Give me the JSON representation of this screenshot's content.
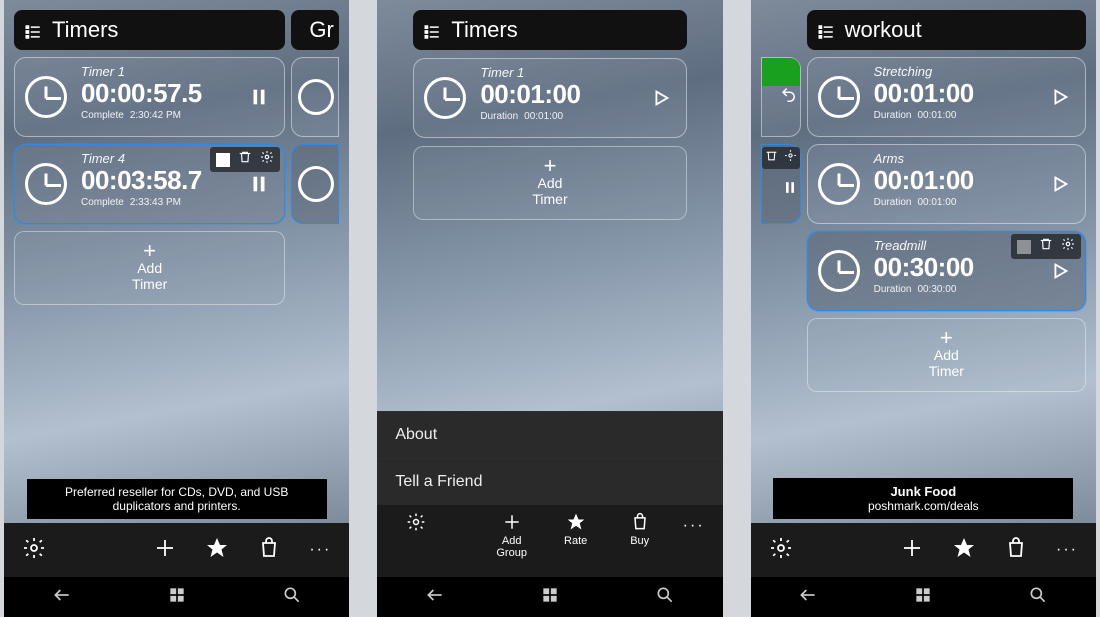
{
  "phone1": {
    "header": "Timers",
    "peek_header": "Gr",
    "timers": [
      {
        "title": "Timer 1",
        "time": "00:00:57.5",
        "meta1": "Complete",
        "meta2": "2:30:42 PM",
        "action": "pause"
      },
      {
        "title": "Timer 4",
        "time": "00:03:58.7",
        "meta1": "Complete",
        "meta2": "2:33:43 PM",
        "action": "pause",
        "selected": true,
        "tools": true
      }
    ],
    "add": {
      "line1": "Add",
      "line2": "Timer"
    },
    "ad": "Preferred reseller for CDs, DVD, and USB duplicators and printers."
  },
  "phone2": {
    "header": "Timers",
    "timer": {
      "title": "Timer 1",
      "time": "00:01:00",
      "meta1": "Duration",
      "meta2": "00:01:00",
      "action": "play"
    },
    "add": {
      "line1": "Add",
      "line2": "Timer"
    },
    "menu": [
      "About",
      "Tell a Friend"
    ],
    "appbar": [
      {
        "name": "settings",
        "label": ""
      },
      {
        "name": "add-group",
        "label": "Add\nGroup"
      },
      {
        "name": "rate",
        "label": "Rate"
      },
      {
        "name": "buy",
        "label": "Buy"
      }
    ]
  },
  "phone3": {
    "header": "workout",
    "left_peek_action": "pause",
    "timers": [
      {
        "title": "Stretching",
        "time": "00:01:00",
        "meta1": "Duration",
        "meta2": "00:01:00",
        "action": "play"
      },
      {
        "title": "Arms",
        "time": "00:01:00",
        "meta1": "Duration",
        "meta2": "00:01:00",
        "action": "play"
      },
      {
        "title": "Treadmill",
        "time": "00:30:00",
        "meta1": "Duration",
        "meta2": "00:30:00",
        "action": "play",
        "selected": true,
        "tools": true
      }
    ],
    "add": {
      "line1": "Add",
      "line2": "Timer"
    },
    "ad": {
      "line1": "Junk Food",
      "line2": "poshmark.com/deals"
    }
  }
}
